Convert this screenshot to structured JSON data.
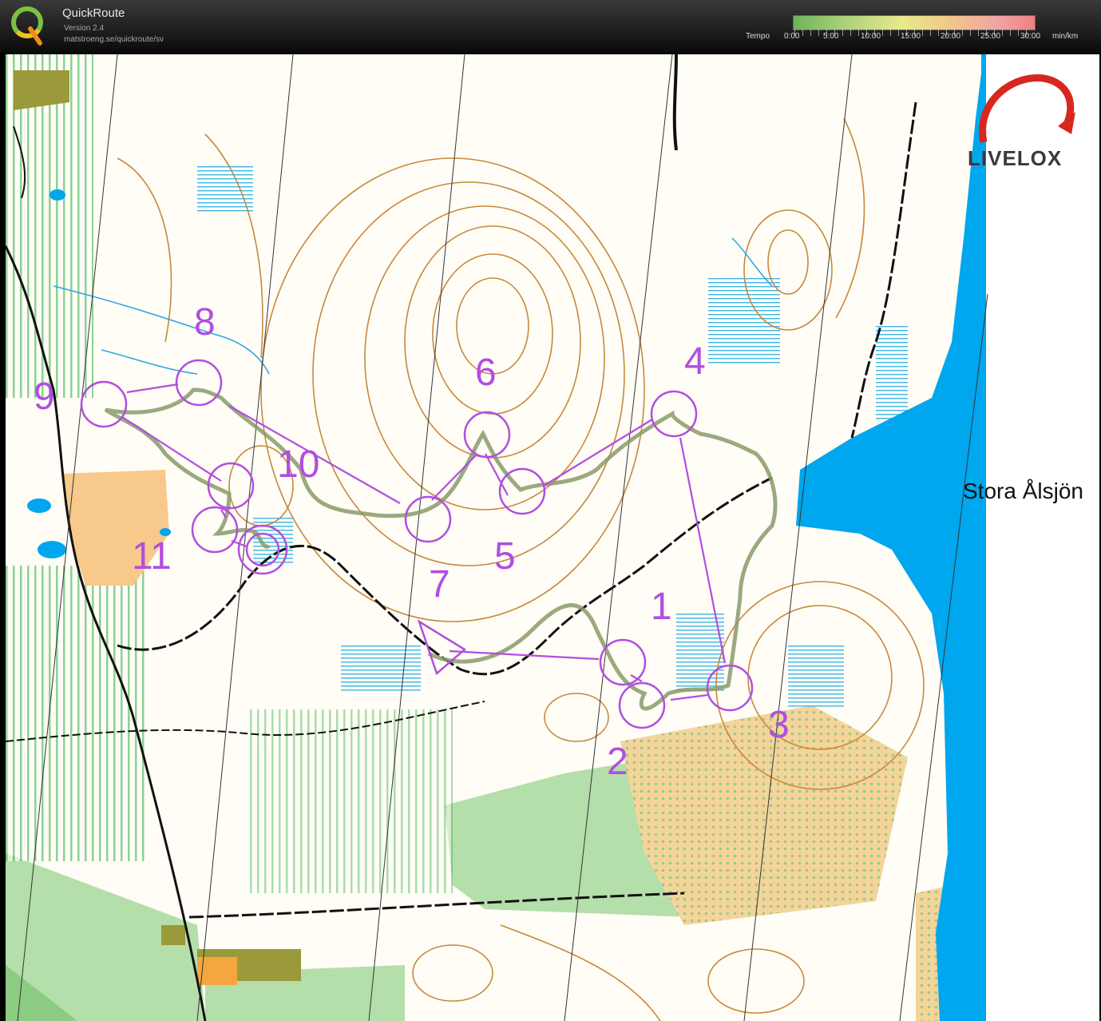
{
  "app": {
    "title": "QuickRoute",
    "version": "Version 2.4",
    "url": "matstroeng.se/quickroute/sv"
  },
  "tempo_legend": {
    "label": "Tempo",
    "ticks": [
      "0:00",
      "5:00",
      "10:00",
      "15:00",
      "20:00",
      "25:00",
      "30:00"
    ],
    "unit": "min/km"
  },
  "map": {
    "logo_text": "LIVELOX",
    "lake_label": "Stora Ålsjön",
    "colors": {
      "course": "#b14ee0",
      "route": "#8a9a6a",
      "water": "#00a6ee",
      "contour": "#c8883a",
      "open_land": "#f7c98a",
      "green": "#a8d8a0"
    },
    "controls": [
      {
        "label": "1"
      },
      {
        "label": "2"
      },
      {
        "label": "3"
      },
      {
        "label": "4"
      },
      {
        "label": "5"
      },
      {
        "label": "6"
      },
      {
        "label": "7"
      },
      {
        "label": "8"
      },
      {
        "label": "9"
      },
      {
        "label": "10"
      },
      {
        "label": "11"
      }
    ]
  }
}
